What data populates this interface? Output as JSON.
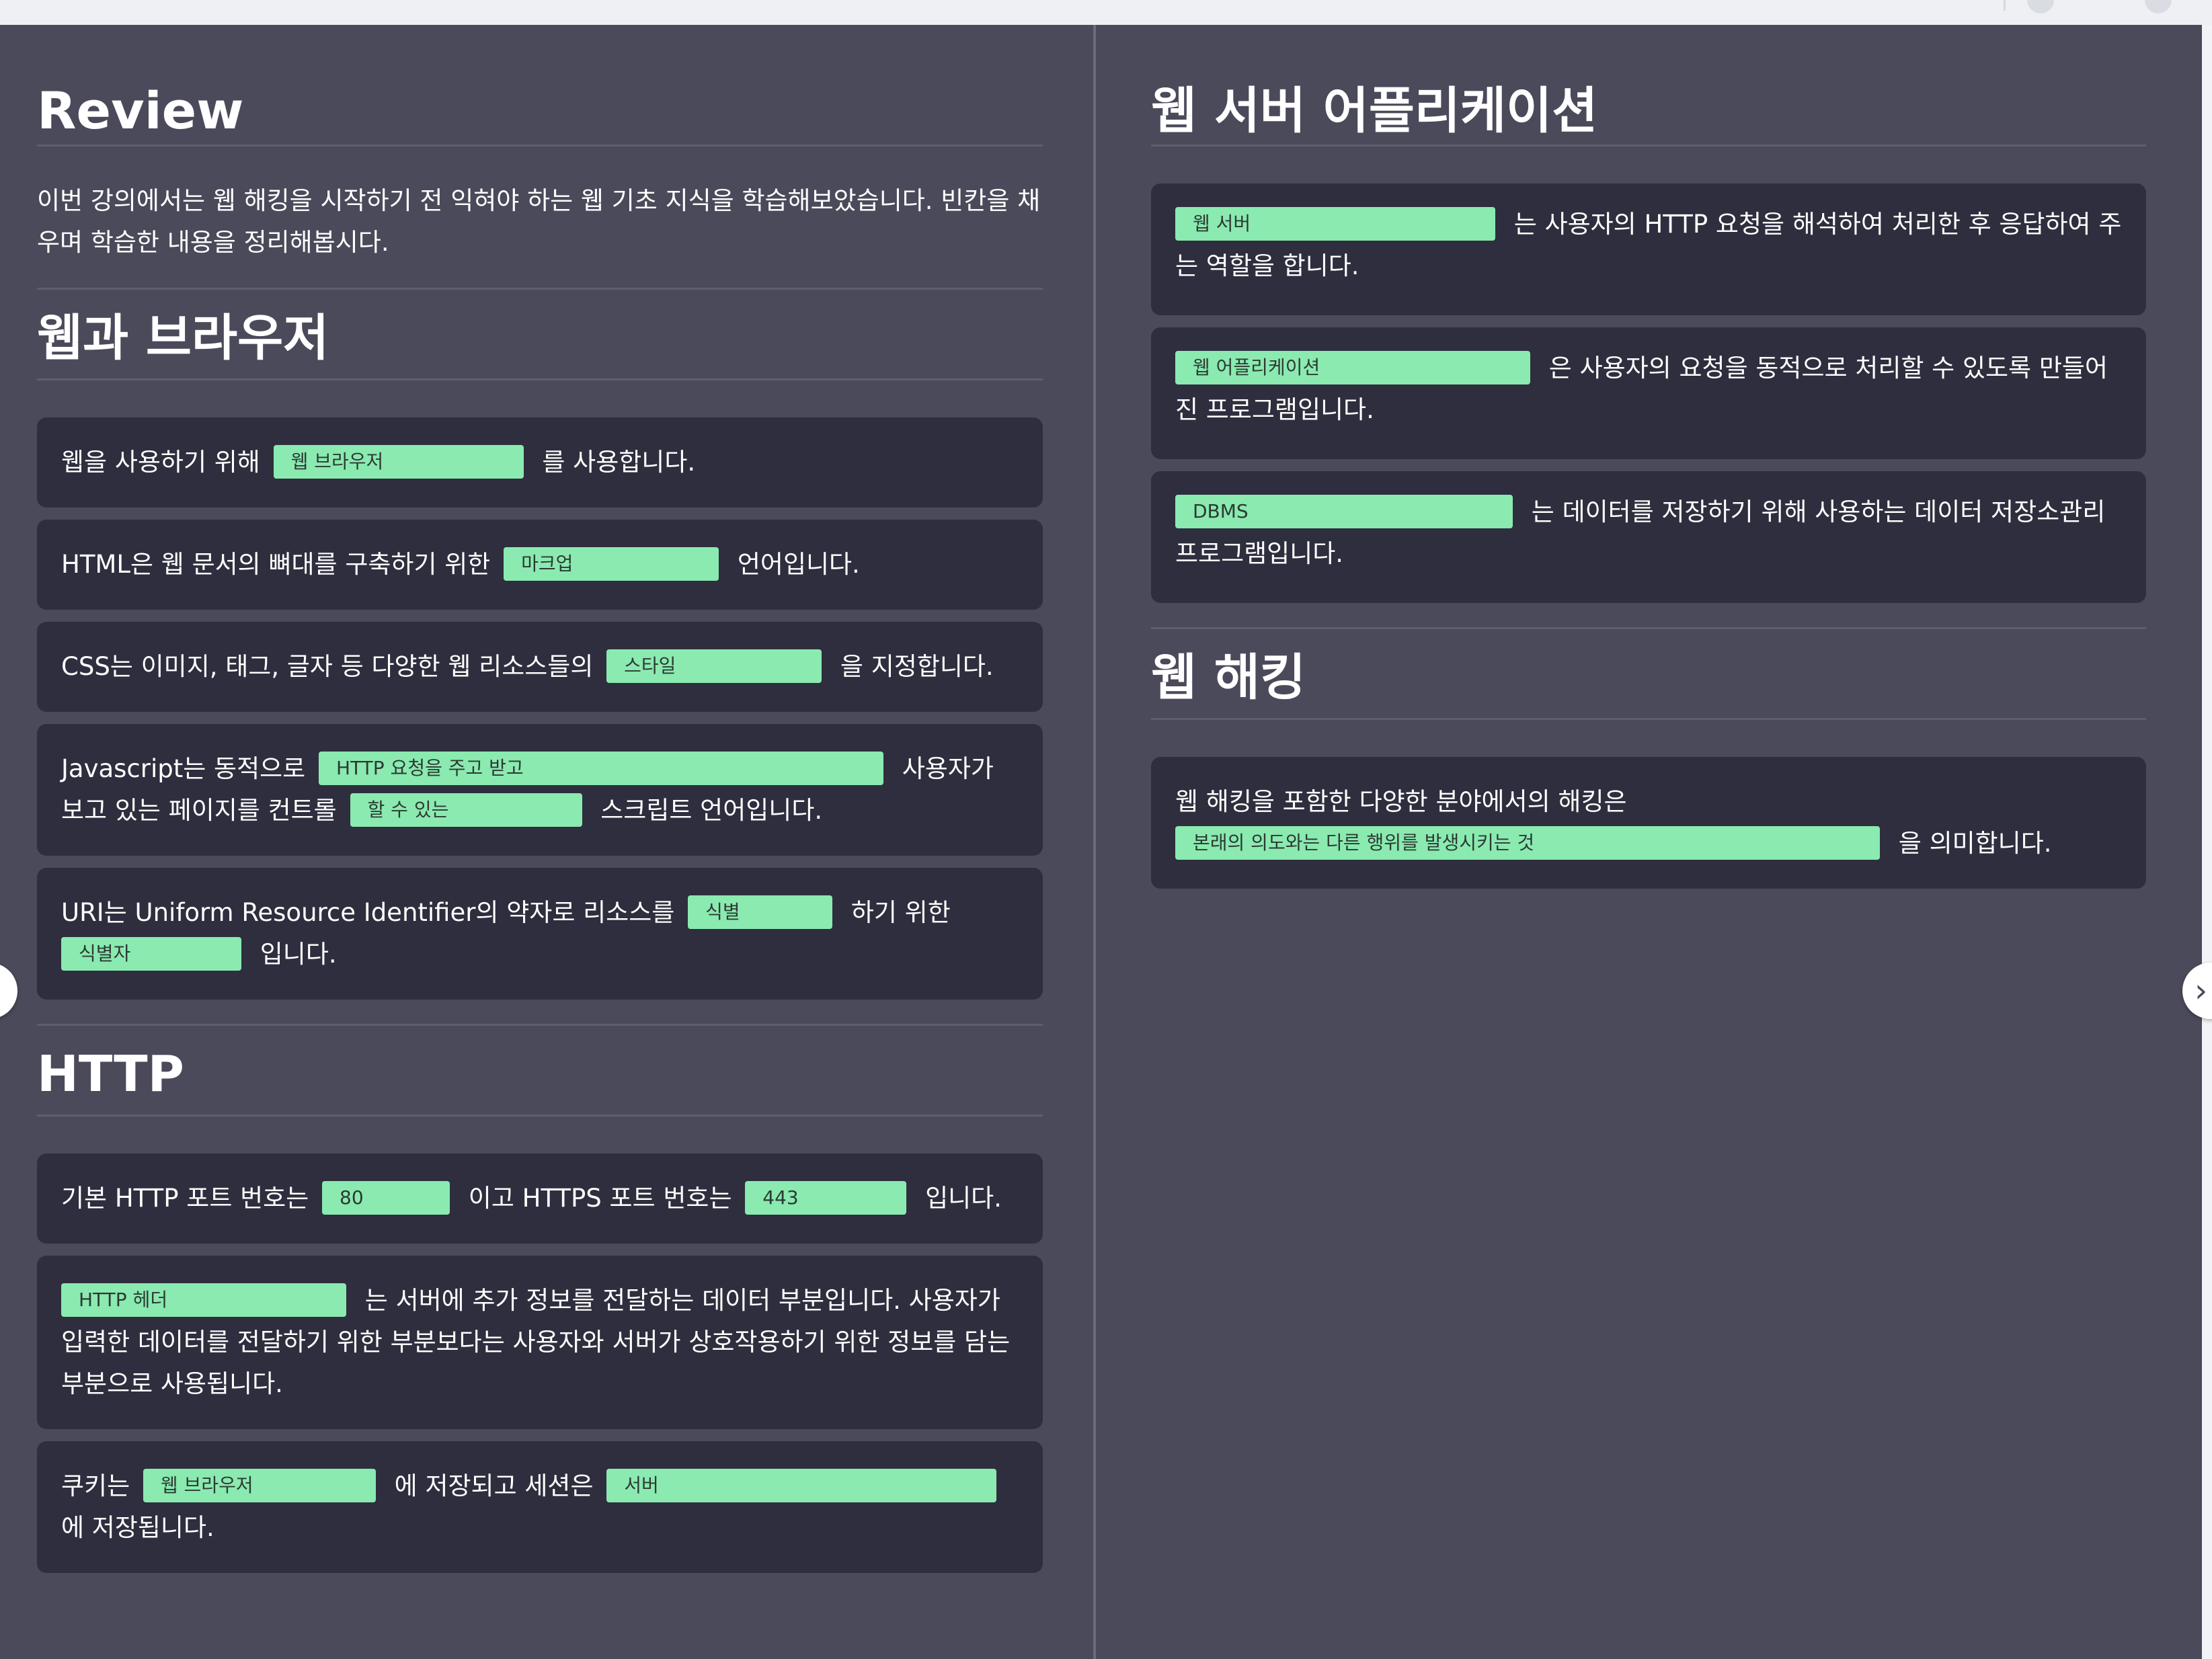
{
  "left": {
    "review": {
      "title": "Review",
      "intro": "이번 강의에서는 웹 해킹을 시작하기 전 익혀야 하는 웹 기초 지식을 학습해보았습니다. 빈칸을 채우며 학습한 내용을 정리해봅시다."
    },
    "web_browser": {
      "title": "웹과 브라우저",
      "q1": {
        "pre": "웹을 사용하기 위해",
        "blank": "웹 브라우저",
        "post": "를 사용합니다."
      },
      "q2": {
        "pre": "HTML은 웹 문서의 뼈대를 구축하기 위한",
        "blank": "마크업",
        "post": "언어입니다."
      },
      "q3": {
        "pre": "CSS는 이미지, 태그, 글자 등 다양한 웹 리소스들의",
        "blank": "스타일",
        "post": "을 지정합니다."
      },
      "q4": {
        "pre": "Javascript는 동적으로",
        "blank1": "HTTP 요청을 주고 받고",
        "mid": "사용자가 보고 있는 페이지를 컨트롤",
        "blank2": "할 수 있는",
        "post": "스크립트 언어입니다."
      },
      "q5": {
        "pre": "URI는 Uniform Resource Identifier의 약자로 리소스를",
        "blank1": "식별",
        "mid": "하기 위한",
        "blank2": "식별자",
        "post": "입니다."
      }
    },
    "http": {
      "title": "HTTP",
      "q1": {
        "pre": "기본 HTTP 포트 번호는",
        "blank1": "80",
        "mid": "이고 HTTPS 포트 번호는",
        "blank2": "443",
        "post": "입니다."
      },
      "q2": {
        "blank": "HTTP 헤더",
        "post": "는 서버에 추가 정보를 전달하는 데이터 부분입니다. 사용자가 입력한 데이터를 전달하기 위한 부분보다는 사용자와 서버가 상호작용하기 위한 정보를 담는 부분으로 사용됩니다."
      },
      "q3": {
        "pre": "쿠키는",
        "blank1": "웹 브라우저",
        "mid": "에 저장되고 세션은",
        "blank2": "서버",
        "post": "에 저장됩니다."
      }
    }
  },
  "right": {
    "web_server_app": {
      "title": "웹 서버 어플리케이션",
      "q1": {
        "blank": "웹 서버",
        "post": "는 사용자의 HTTP 요청을 해석하여 처리한 후 응답하여 주는 역할을 합니다."
      },
      "q2": {
        "blank": "웹 어플리케이션",
        "post": "은 사용자의 요청을 동적으로 처리할 수 있도록 만들어진 프로그램입니다."
      },
      "q3": {
        "blank": "DBMS",
        "post": "는 데이터를 저장하기 위해 사용하는 데이터 저장소관리 프로그램입니다."
      }
    },
    "web_hacking": {
      "title": "웹 해킹",
      "q1": {
        "pre": "웹 해킹을 포함한 다양한 분야에서의 해킹은",
        "blank": "본래의 의도와는 다른 행위를 발생시키는 것",
        "post": "을 의미합니다."
      }
    }
  },
  "nav": {
    "next_glyph": "›",
    "prev_glyph": "‹"
  },
  "colors": {
    "background": "#4a4a5a",
    "card": "#2e2e3e",
    "blank_fill": "#8aeab0",
    "text": "#ffffff"
  }
}
